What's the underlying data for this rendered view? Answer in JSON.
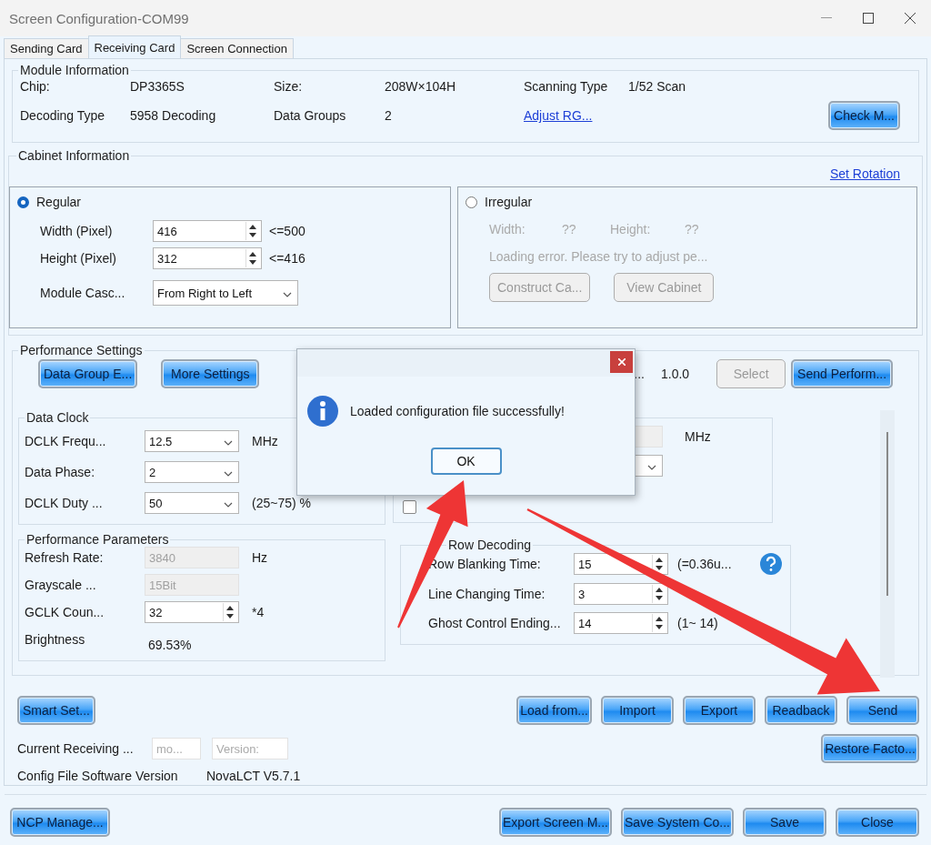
{
  "window": {
    "title": "Screen Configuration-COM99"
  },
  "tabs": [
    {
      "label": "Sending Card",
      "selected": false
    },
    {
      "label": "Receiving Card",
      "selected": true
    },
    {
      "label": "Screen Connection",
      "selected": false
    }
  ],
  "module_information": {
    "title": "Module Information",
    "fields": [
      {
        "label": "Chip:",
        "value": "DP3365S"
      },
      {
        "label": "Size:",
        "value": "208W×104H"
      },
      {
        "label": "Scanning Type",
        "value": "1/52 Scan"
      },
      {
        "label": "Decoding Type",
        "value": "5958 Decoding"
      },
      {
        "label": "Data Groups",
        "value": "2"
      }
    ],
    "link": "Adjust RG...",
    "button": "Check M..."
  },
  "cabinet_information": {
    "title": "Cabinet Information",
    "link": "Set Rotation",
    "regular": {
      "label": "Regular",
      "selected": true,
      "rows": [
        {
          "label": "Width (Pixel)",
          "value": "416",
          "hint": "<=500"
        },
        {
          "label": "Height (Pixel)",
          "value": "312",
          "hint": "<=416"
        }
      ],
      "cascade": {
        "label": "Module Casc...",
        "value": "From Right to Left"
      }
    },
    "irregular": {
      "label": "Irregular",
      "selected": false,
      "width_label": "Width:",
      "width_value": "??",
      "height_label": "Height:",
      "height_value": "??",
      "message": "Loading error. Please try to adjust pe...",
      "buttons": [
        "Construct Ca...",
        "View Cabinet"
      ]
    }
  },
  "performance_settings": {
    "title": "Performance Settings",
    "buttons": [
      "Data Group E...",
      "More Settings"
    ],
    "version_label": "...",
    "version": "1.0.0",
    "select_button": {
      "label": "Select",
      "disabled": true
    },
    "send_button": "Send Perform...",
    "data_clock": {
      "title": "Data Clock",
      "rows": [
        {
          "label": "DCLK Frequ...",
          "kind": "dropdown",
          "value": "12.5",
          "unit": "MHz"
        },
        {
          "label": "Data Phase:",
          "kind": "dropdown",
          "value": "2"
        },
        {
          "label": "DCLK Duty ...",
          "kind": "dropdown",
          "value": "50",
          "unit": "(25~75) %"
        }
      ]
    },
    "performance_parameters": {
      "title": "Performance Parameters",
      "rows": [
        {
          "label": "Refresh Rate:",
          "kind": "readonly",
          "value": "3840",
          "unit": "Hz"
        },
        {
          "label": "Grayscale ...",
          "kind": "readonly",
          "value": "15Bit"
        },
        {
          "label": "GCLK Coun...",
          "kind": "spin",
          "value": "32",
          "unit": "*4"
        },
        {
          "label": "Brightness",
          "kind": "text",
          "value": "69.53%"
        }
      ]
    },
    "clock_group": {
      "unit": "MHz",
      "checked": false
    },
    "row_decoding": {
      "title": "Row Decoding",
      "rows": [
        {
          "label": "Row Blanking Time:",
          "value": "15",
          "note": "(=0.36u...",
          "help": true
        },
        {
          "label": "Line Changing Time:",
          "value": "3",
          "help": false
        },
        {
          "label": "Ghost Control Ending...",
          "value": "14",
          "note": "(1~ 14)",
          "help": false
        }
      ]
    }
  },
  "bottom": {
    "smart_button": "Smart Set...",
    "actions": [
      "Load from...",
      "Import",
      "Export",
      "Readback",
      "Send"
    ],
    "current_receiving": {
      "label": "Current Receiving ...",
      "model_placeholder": "mo...",
      "version_placeholder": "Version:"
    },
    "restore_button": "Restore Facto...",
    "config_version": {
      "label": "Config File Software Version",
      "value": "NovaLCT V5.7.1"
    }
  },
  "footer": {
    "left_button": "NCP Manage...",
    "buttons": [
      "Export Screen M...",
      "Save System Co...",
      "Save",
      "Close"
    ]
  },
  "dialog": {
    "message": "Loaded configuration file successfully!",
    "button": "OK"
  }
}
